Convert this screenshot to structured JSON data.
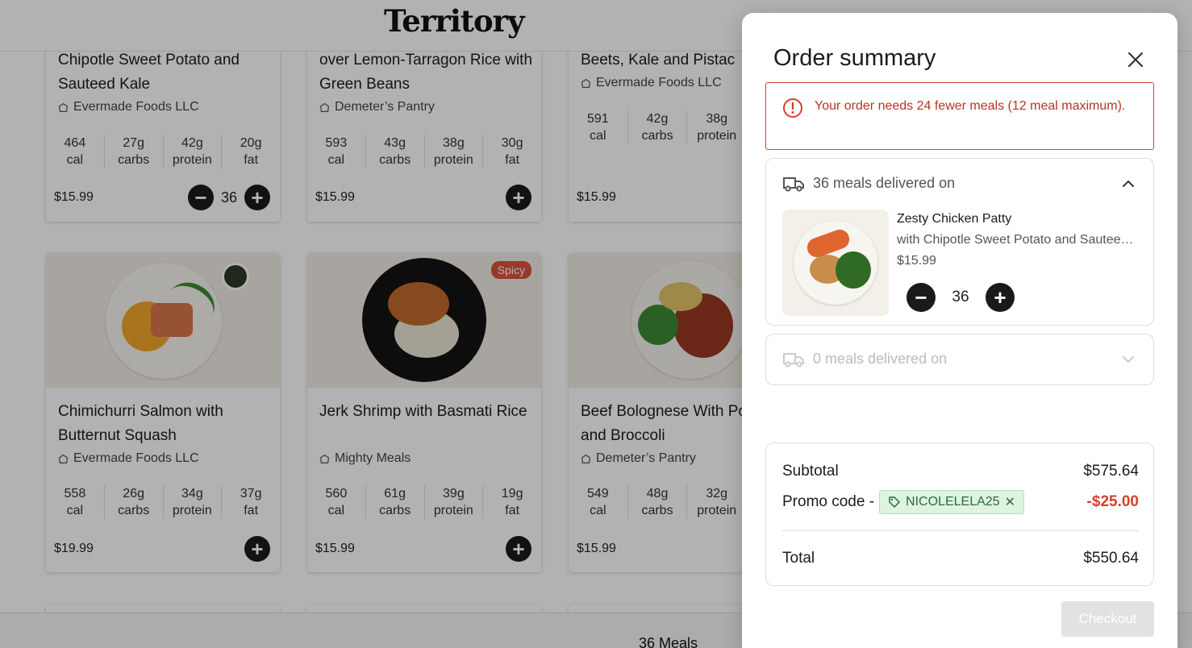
{
  "header": {
    "logo": "Territory"
  },
  "cards": [
    {
      "title_line": "Chipotle Sweet Potato and Sauteed Kale",
      "vendor": "Evermade Foods LLC",
      "nutrition": [
        [
          "464",
          "cal"
        ],
        [
          "27g",
          "carbs"
        ],
        [
          "42g",
          "protein"
        ],
        [
          "20g",
          "fat"
        ]
      ],
      "price": "$15.99",
      "qty": "36"
    },
    {
      "title_line": "over Lemon-Tarragon Rice with Green Beans",
      "vendor": "Demeter’s Pantry",
      "nutrition": [
        [
          "593",
          "cal"
        ],
        [
          "43g",
          "carbs"
        ],
        [
          "38g",
          "protein"
        ],
        [
          "30g",
          "fat"
        ]
      ],
      "price": "$15.99"
    },
    {
      "title_line": "Beets, Kale and Pistac",
      "vendor": "Evermade Foods LLC",
      "nutrition": [
        [
          "591",
          "cal"
        ],
        [
          "42g",
          "carbs"
        ],
        [
          "38g",
          "protein"
        ]
      ],
      "price": "$15.99"
    },
    {
      "title_line": "Chimichurri Salmon with Butternut Squash",
      "vendor": "Evermade Foods LLC",
      "nutrition": [
        [
          "558",
          "cal"
        ],
        [
          "26g",
          "carbs"
        ],
        [
          "34g",
          "protein"
        ],
        [
          "37g",
          "fat"
        ]
      ],
      "price": "$19.99"
    },
    {
      "title_line": "Jerk Shrimp with Basmati Rice",
      "vendor": "Mighty Meals",
      "badge": "Spicy",
      "nutrition": [
        [
          "560",
          "cal"
        ],
        [
          "61g",
          "carbs"
        ],
        [
          "39g",
          "protein"
        ],
        [
          "19g",
          "fat"
        ]
      ],
      "price": "$15.99"
    },
    {
      "title_line": "Beef Bolognese With Potatoes and Broccoli",
      "vendor": "Demeter’s Pantry",
      "nutrition": [
        [
          "549",
          "cal"
        ],
        [
          "48g",
          "carbs"
        ],
        [
          "32g",
          "protein"
        ]
      ],
      "price": "$15.99"
    }
  ],
  "footer": {
    "meals_count": "36 Meals"
  },
  "modal": {
    "title": "Order summary",
    "alert": "Your order needs 24 fewer meals (12 meal maximum).",
    "delivery1": {
      "label": "36 meals delivered on",
      "item": {
        "name": "Zesty Chicken Patty",
        "sub": "with Chipotle Sweet Potato and Sauteed Kale",
        "price": "$15.99",
        "qty": "36"
      }
    },
    "delivery2": {
      "label": "0 meals delivered on"
    },
    "summary": {
      "subtotal_label": "Subtotal",
      "subtotal": "$575.64",
      "promo_label": "Promo code -",
      "promo_code": "NICOLELELA25",
      "discount": "-$25.00",
      "total_label": "Total",
      "total": "$550.64"
    },
    "checkout": "Checkout"
  }
}
